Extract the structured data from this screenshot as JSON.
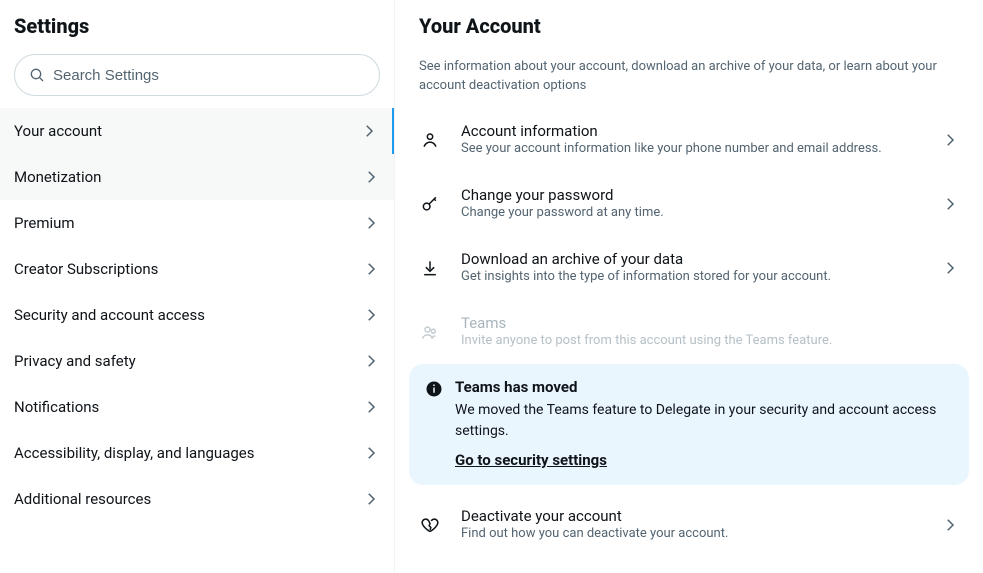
{
  "sidebar": {
    "title": "Settings",
    "search_placeholder": "Search Settings",
    "items": [
      {
        "label": "Your account"
      },
      {
        "label": "Monetization"
      },
      {
        "label": "Premium"
      },
      {
        "label": "Creator Subscriptions"
      },
      {
        "label": "Security and account access"
      },
      {
        "label": "Privacy and safety"
      },
      {
        "label": "Notifications"
      },
      {
        "label": "Accessibility, display, and languages"
      },
      {
        "label": "Additional resources"
      }
    ]
  },
  "main": {
    "title": "Your Account",
    "description": "See information about your account, download an archive of your data, or learn about your account deactivation options",
    "rows": [
      {
        "title": "Account information",
        "sub": "See your account information like your phone number and email address."
      },
      {
        "title": "Change your password",
        "sub": "Change your password at any time."
      },
      {
        "title": "Download an archive of your data",
        "sub": "Get insights into the type of information stored for your account."
      },
      {
        "title": "Teams",
        "sub": "Invite anyone to post from this account using the Teams feature."
      },
      {
        "title": "Deactivate your account",
        "sub": "Find out how you can deactivate your account."
      }
    ],
    "callout": {
      "title": "Teams has moved",
      "text": "We moved the Teams feature to Delegate in your security and account access settings.",
      "link": "Go to security settings"
    }
  }
}
